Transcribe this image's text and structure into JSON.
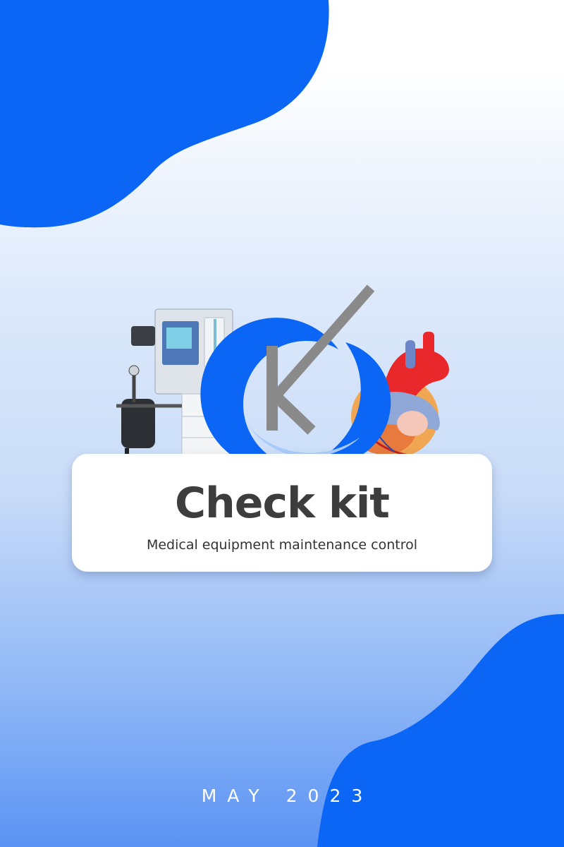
{
  "colors": {
    "accent": "#0b66f5",
    "background_top": "#ffffff",
    "background_bottom": "#5b93f4",
    "card": "#ffffff",
    "title": "#3d3d3d"
  },
  "hero": {
    "logo_icon": "k-checkmark-logo-icon",
    "left_image": "anesthesia-machine-image",
    "right_image": "heart-model-image"
  },
  "card": {
    "title": "Check kit",
    "subtitle": "Medical equipment maintenance control"
  },
  "footer": {
    "date": "MAY 2023"
  }
}
